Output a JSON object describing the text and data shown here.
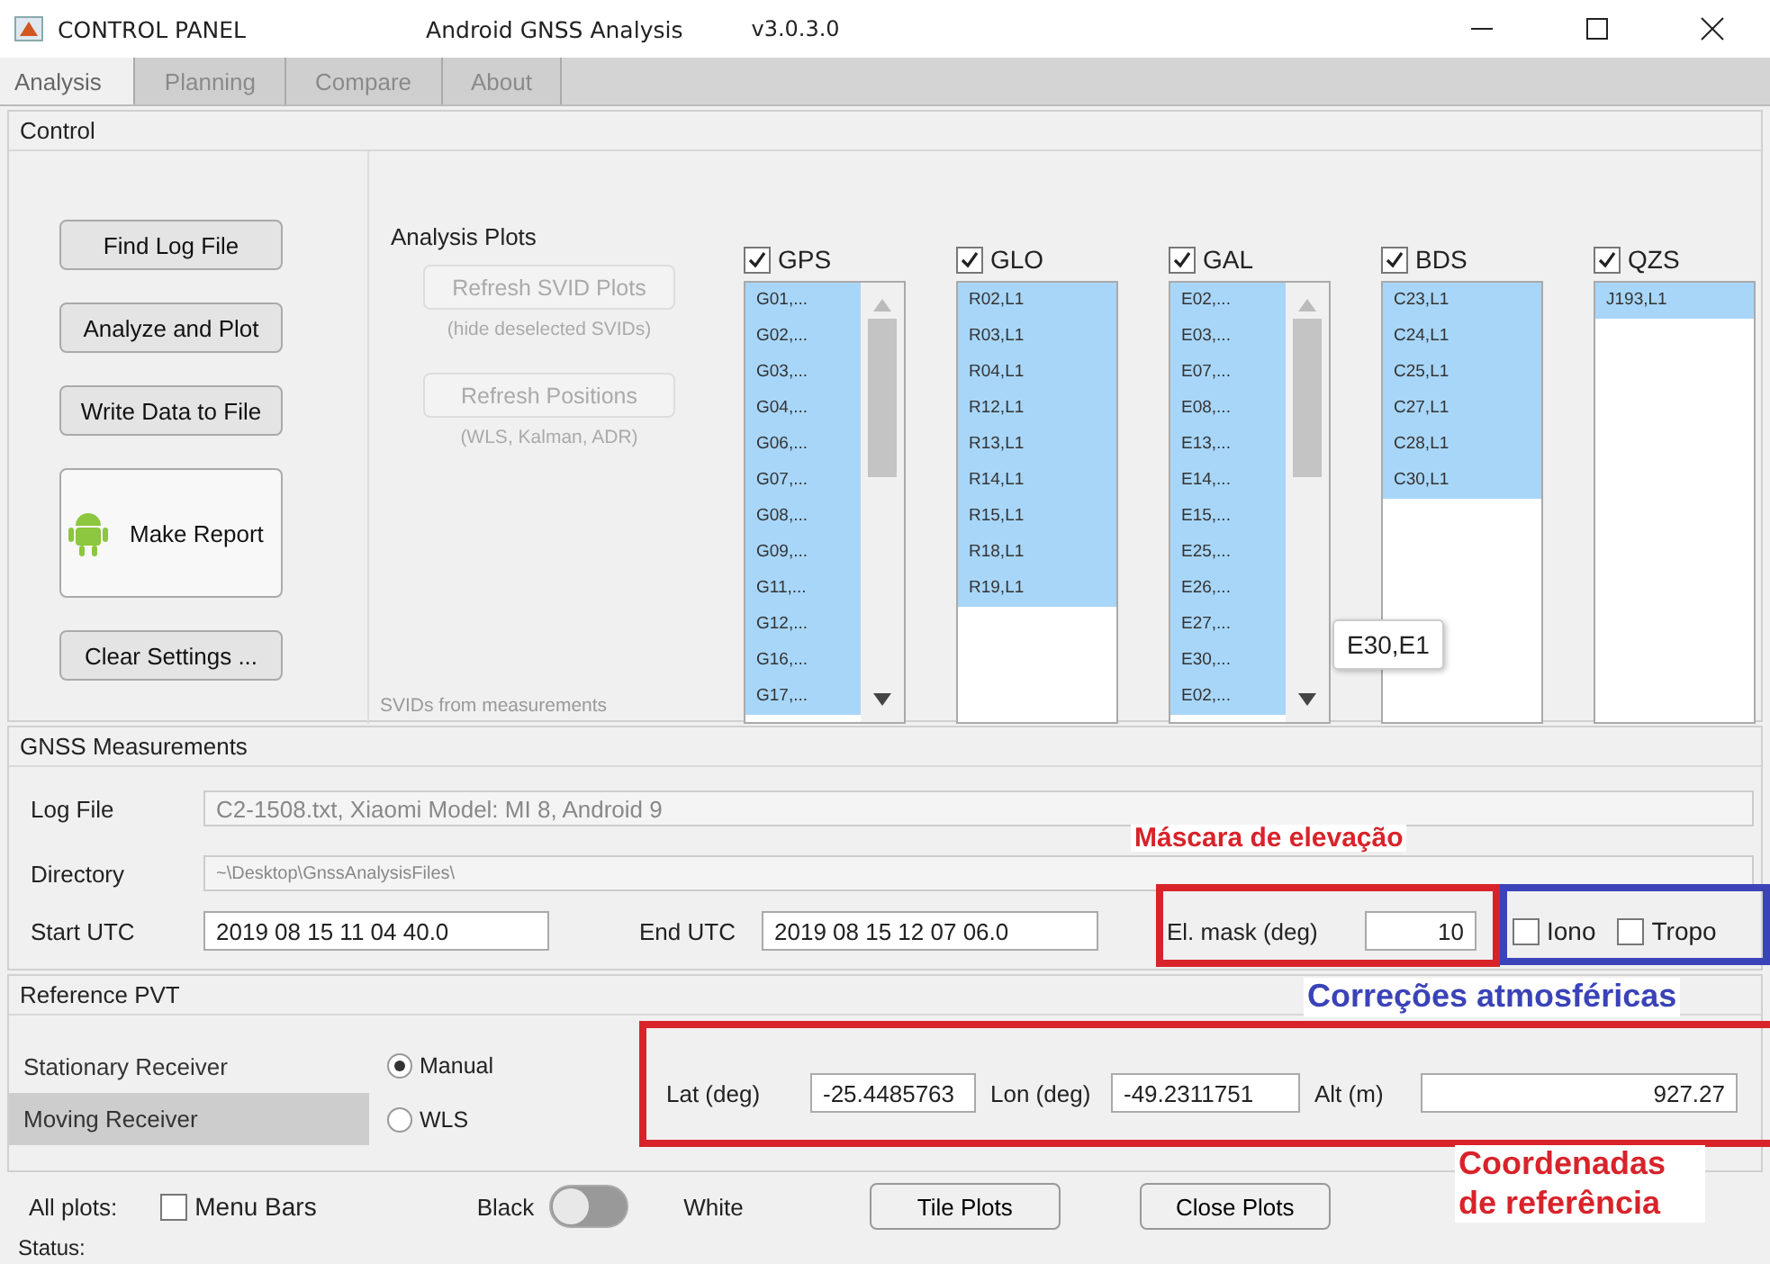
{
  "window": {
    "title": "CONTROL PANEL",
    "subtitle": "Android GNSS Analysis",
    "version": "v3.0.3.0"
  },
  "tabs": [
    {
      "label": "Analysis",
      "selected": true
    },
    {
      "label": "Planning",
      "selected": false
    },
    {
      "label": "Compare",
      "selected": false
    },
    {
      "label": "About",
      "selected": false
    }
  ],
  "control": {
    "title": "Control",
    "buttons": [
      {
        "label": "Find Log File",
        "kind": "normal"
      },
      {
        "label": "Analyze and Plot",
        "kind": "normal"
      },
      {
        "label": "Write Data to File",
        "kind": "normal"
      },
      {
        "label": "Make Report",
        "kind": "report"
      },
      {
        "label": "Clear Settings ...",
        "kind": "normal"
      }
    ],
    "analysis_plots": {
      "title": "Analysis Plots",
      "refresh_svid": {
        "label": "Refresh SVID Plots",
        "disabled": true
      },
      "refresh_svid_hint": "(hide deselected SVIDs)",
      "refresh_positions": {
        "label": "Refresh Positions",
        "disabled": true
      },
      "refresh_positions_hint": "(WLS, Kalman, ADR)",
      "footer": "SVIDs from measurements"
    },
    "constellations": [
      {
        "name": "GPS",
        "checked": true,
        "items": [
          {
            "label": "G01,...",
            "selected": true
          },
          {
            "label": "G02,...",
            "selected": true
          },
          {
            "label": "G03,...",
            "selected": true
          },
          {
            "label": "G04,...",
            "selected": true
          },
          {
            "label": "G06,...",
            "selected": true
          },
          {
            "label": "G07,...",
            "selected": true
          },
          {
            "label": "G08,...",
            "selected": true
          },
          {
            "label": "G09,...",
            "selected": true
          },
          {
            "label": "G11,...",
            "selected": true
          },
          {
            "label": "G12,...",
            "selected": true
          },
          {
            "label": "G16,...",
            "selected": true
          },
          {
            "label": "G17,...",
            "selected": true
          }
        ]
      },
      {
        "name": "GLO",
        "checked": true,
        "items": [
          {
            "label": "R02,L1",
            "selected": true
          },
          {
            "label": "R03,L1",
            "selected": true
          },
          {
            "label": "R04,L1",
            "selected": true
          },
          {
            "label": "R12,L1",
            "selected": true
          },
          {
            "label": "R13,L1",
            "selected": true
          },
          {
            "label": "R14,L1",
            "selected": true
          },
          {
            "label": "R15,L1",
            "selected": true
          },
          {
            "label": "R18,L1",
            "selected": true
          },
          {
            "label": "R19,L1",
            "selected": true
          }
        ]
      },
      {
        "name": "GAL",
        "checked": true,
        "items": [
          {
            "label": "E02,...",
            "selected": true
          },
          {
            "label": "E03,...",
            "selected": true
          },
          {
            "label": "E07,...",
            "selected": true
          },
          {
            "label": "E08,...",
            "selected": true
          },
          {
            "label": "E13,...",
            "selected": true
          },
          {
            "label": "E14,...",
            "selected": true
          },
          {
            "label": "E15,...",
            "selected": true
          },
          {
            "label": "E25,...",
            "selected": true
          },
          {
            "label": "E26,...",
            "selected": true
          },
          {
            "label": "E27,...",
            "selected": true
          },
          {
            "label": "E30,...",
            "selected": true
          },
          {
            "label": "E02,...",
            "selected": true
          }
        ]
      },
      {
        "name": "BDS",
        "checked": true,
        "items": [
          {
            "label": "C23,L1",
            "selected": true
          },
          {
            "label": "C24,L1",
            "selected": true
          },
          {
            "label": "C25,L1",
            "selected": true
          },
          {
            "label": "C27,L1",
            "selected": true
          },
          {
            "label": "C28,L1",
            "selected": true
          },
          {
            "label": "C30,L1",
            "selected": true
          }
        ]
      },
      {
        "name": "QZS",
        "checked": true,
        "items": [
          {
            "label": "J193,L1",
            "selected": true
          }
        ]
      }
    ],
    "tooltip": "E30,E1"
  },
  "measurements": {
    "title": "GNSS Measurements",
    "log_file": {
      "label": "Log File",
      "value": "C2-1508.txt, Xiaomi Model: MI 8, Android 9"
    },
    "directory": {
      "label": "Directory",
      "value": "~\\Desktop\\GnssAnalysisFiles\\"
    },
    "start": {
      "label": "Start UTC",
      "value": "2019 08 15 11 04 40.0"
    },
    "end": {
      "label": "End UTC",
      "value": "2019 08 15 12 07 06.0"
    },
    "el_mask": {
      "label": "El. mask (deg)",
      "value": "10"
    },
    "iono": {
      "label": "Iono",
      "checked": false
    },
    "tropo": {
      "label": "Tropo",
      "checked": false
    }
  },
  "reference_pvt": {
    "title": "Reference PVT",
    "receivers": [
      {
        "label": "Stationary Receiver",
        "selected": false
      },
      {
        "label": "Moving Receiver",
        "selected": true
      }
    ],
    "modes": [
      {
        "label": "Manual",
        "selected": true
      },
      {
        "label": "WLS",
        "selected": false
      }
    ],
    "lat": {
      "label": "Lat (deg)",
      "value": "-25.4485763"
    },
    "lon": {
      "label": "Lon (deg)",
      "value": "-49.2311751"
    },
    "alt": {
      "label": "Alt (m)",
      "value": "927.27"
    }
  },
  "bottom": {
    "label": "All plots:",
    "menu_bars": {
      "label": "Menu Bars",
      "checked": false
    },
    "toggle": {
      "off_label": "Black",
      "on_label": "White",
      "on": false
    },
    "buttons": [
      "Tile Plots",
      "Close Plots"
    ]
  },
  "status": {
    "label": "Status:"
  },
  "annotations": [
    {
      "kind": "label",
      "text": "Máscara de elevação",
      "color": "#d8232a"
    },
    {
      "kind": "label",
      "text": "Correções atmosféricas",
      "color": "#3a43b8"
    },
    {
      "kind": "label",
      "text": "Coordenadas de referência",
      "color": "#d8232a"
    }
  ],
  "annotation_boxes": [
    {
      "color": "#d8232a"
    },
    {
      "color": "#3a43b8"
    },
    {
      "color": "#d8232a"
    }
  ]
}
